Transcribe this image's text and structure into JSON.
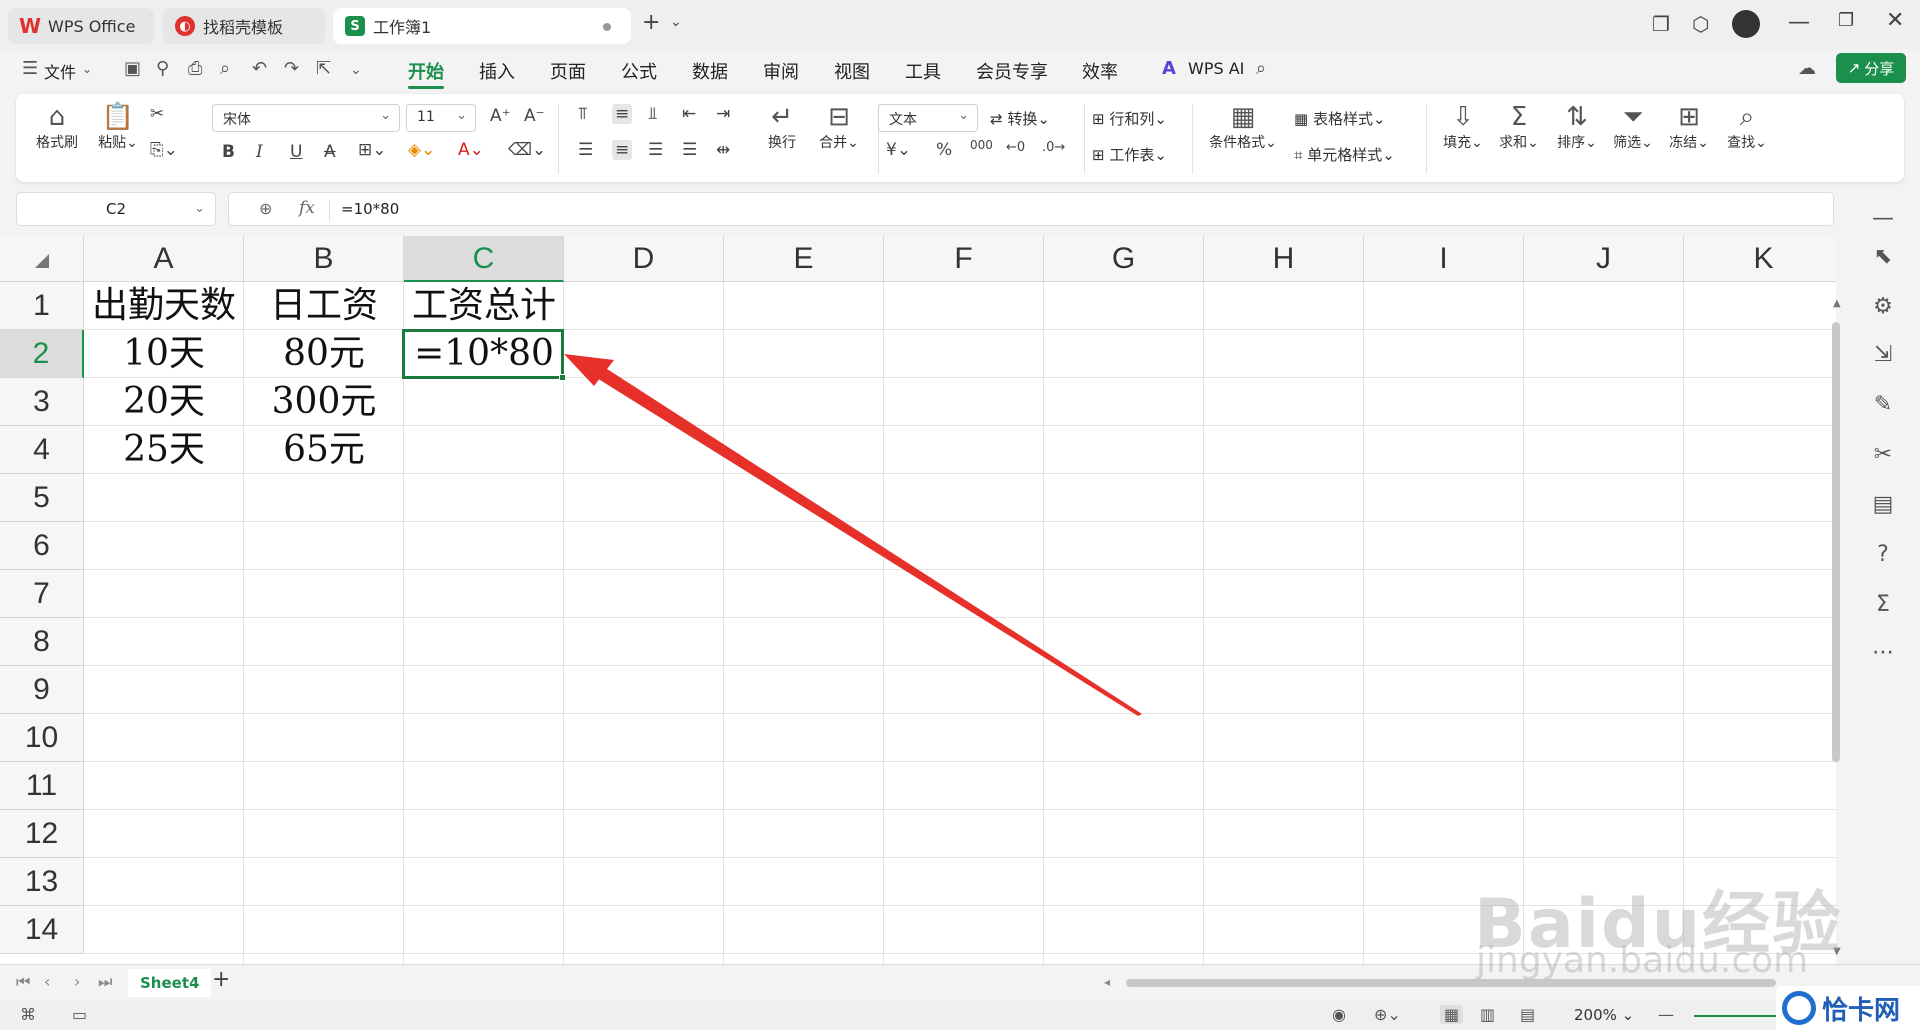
{
  "tabs": [
    {
      "label": "WPS Office",
      "icon": "wps-logo-icon"
    },
    {
      "label": "找稻壳模板",
      "icon": "docer-icon"
    },
    {
      "label": "工作簿1",
      "icon": "spreadsheet-icon"
    }
  ],
  "file_menu": "文件",
  "menu": [
    "开始",
    "插入",
    "页面",
    "公式",
    "数据",
    "审阅",
    "视图",
    "工具",
    "会员专享",
    "效率"
  ],
  "active_menu": "开始",
  "wps_ai": "WPS AI",
  "share": "分享",
  "ribbon": {
    "format_painter": "格式刷",
    "paste": "粘贴",
    "font_name": "宋体",
    "font_size": "11",
    "bold": "B",
    "italic": "I",
    "underline": "U",
    "wrap": "换行",
    "merge": "合并",
    "number_format": "文本",
    "convert": "转换",
    "rows_cols": "行和列",
    "worksheet": "工作表",
    "cond_format": "条件格式",
    "table_style": "表格样式",
    "cell_style": "单元格样式",
    "fill": "填充",
    "sum": "求和",
    "sort": "排序",
    "filter": "筛选",
    "freeze": "冻结",
    "find": "查找",
    "currency": "¥",
    "percent": "%",
    "thousands": "000"
  },
  "name_box": "C2",
  "fx_label": "fx",
  "formula": "=10*80",
  "columns": [
    "A",
    "B",
    "C",
    "D",
    "E",
    "F",
    "G",
    "H",
    "I",
    "J",
    "K"
  ],
  "rows": [
    "1",
    "2",
    "3",
    "4",
    "5",
    "6",
    "7",
    "8",
    "9",
    "10",
    "11",
    "12",
    "13",
    "14"
  ],
  "cells": {
    "A1": "出勤天数",
    "B1": "日工资",
    "C1": "工资总计",
    "A2": "10天",
    "B2": "80元",
    "C2": "=10*80",
    "A3": "20天",
    "B3": "300元",
    "A4": "25天",
    "B4": "65元"
  },
  "sheet_tab": "Sheet4",
  "zoom": "200%",
  "watermark": {
    "brand": "Baidu经验",
    "url": "jingyan.baidu.com",
    "badge": "恰卡网"
  },
  "colors": {
    "accent": "#1b8f4c",
    "arrow": "#e8302a",
    "active_border": "#1b7a3f"
  }
}
